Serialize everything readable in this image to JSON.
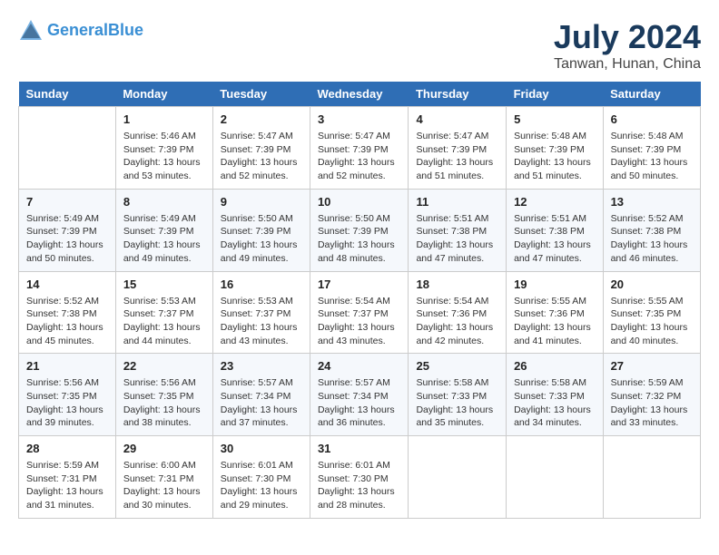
{
  "header": {
    "logo_line1": "General",
    "logo_line2": "Blue",
    "month_year": "July 2024",
    "location": "Tanwan, Hunan, China"
  },
  "days_of_week": [
    "Sunday",
    "Monday",
    "Tuesday",
    "Wednesday",
    "Thursday",
    "Friday",
    "Saturday"
  ],
  "weeks": [
    [
      {
        "day": "",
        "sunrise": "",
        "sunset": "",
        "daylight": ""
      },
      {
        "day": "1",
        "sunrise": "Sunrise: 5:46 AM",
        "sunset": "Sunset: 7:39 PM",
        "daylight": "Daylight: 13 hours and 53 minutes."
      },
      {
        "day": "2",
        "sunrise": "Sunrise: 5:47 AM",
        "sunset": "Sunset: 7:39 PM",
        "daylight": "Daylight: 13 hours and 52 minutes."
      },
      {
        "day": "3",
        "sunrise": "Sunrise: 5:47 AM",
        "sunset": "Sunset: 7:39 PM",
        "daylight": "Daylight: 13 hours and 52 minutes."
      },
      {
        "day": "4",
        "sunrise": "Sunrise: 5:47 AM",
        "sunset": "Sunset: 7:39 PM",
        "daylight": "Daylight: 13 hours and 51 minutes."
      },
      {
        "day": "5",
        "sunrise": "Sunrise: 5:48 AM",
        "sunset": "Sunset: 7:39 PM",
        "daylight": "Daylight: 13 hours and 51 minutes."
      },
      {
        "day": "6",
        "sunrise": "Sunrise: 5:48 AM",
        "sunset": "Sunset: 7:39 PM",
        "daylight": "Daylight: 13 hours and 50 minutes."
      }
    ],
    [
      {
        "day": "7",
        "sunrise": "Sunrise: 5:49 AM",
        "sunset": "Sunset: 7:39 PM",
        "daylight": "Daylight: 13 hours and 50 minutes."
      },
      {
        "day": "8",
        "sunrise": "Sunrise: 5:49 AM",
        "sunset": "Sunset: 7:39 PM",
        "daylight": "Daylight: 13 hours and 49 minutes."
      },
      {
        "day": "9",
        "sunrise": "Sunrise: 5:50 AM",
        "sunset": "Sunset: 7:39 PM",
        "daylight": "Daylight: 13 hours and 49 minutes."
      },
      {
        "day": "10",
        "sunrise": "Sunrise: 5:50 AM",
        "sunset": "Sunset: 7:39 PM",
        "daylight": "Daylight: 13 hours and 48 minutes."
      },
      {
        "day": "11",
        "sunrise": "Sunrise: 5:51 AM",
        "sunset": "Sunset: 7:38 PM",
        "daylight": "Daylight: 13 hours and 47 minutes."
      },
      {
        "day": "12",
        "sunrise": "Sunrise: 5:51 AM",
        "sunset": "Sunset: 7:38 PM",
        "daylight": "Daylight: 13 hours and 47 minutes."
      },
      {
        "day": "13",
        "sunrise": "Sunrise: 5:52 AM",
        "sunset": "Sunset: 7:38 PM",
        "daylight": "Daylight: 13 hours and 46 minutes."
      }
    ],
    [
      {
        "day": "14",
        "sunrise": "Sunrise: 5:52 AM",
        "sunset": "Sunset: 7:38 PM",
        "daylight": "Daylight: 13 hours and 45 minutes."
      },
      {
        "day": "15",
        "sunrise": "Sunrise: 5:53 AM",
        "sunset": "Sunset: 7:37 PM",
        "daylight": "Daylight: 13 hours and 44 minutes."
      },
      {
        "day": "16",
        "sunrise": "Sunrise: 5:53 AM",
        "sunset": "Sunset: 7:37 PM",
        "daylight": "Daylight: 13 hours and 43 minutes."
      },
      {
        "day": "17",
        "sunrise": "Sunrise: 5:54 AM",
        "sunset": "Sunset: 7:37 PM",
        "daylight": "Daylight: 13 hours and 43 minutes."
      },
      {
        "day": "18",
        "sunrise": "Sunrise: 5:54 AM",
        "sunset": "Sunset: 7:36 PM",
        "daylight": "Daylight: 13 hours and 42 minutes."
      },
      {
        "day": "19",
        "sunrise": "Sunrise: 5:55 AM",
        "sunset": "Sunset: 7:36 PM",
        "daylight": "Daylight: 13 hours and 41 minutes."
      },
      {
        "day": "20",
        "sunrise": "Sunrise: 5:55 AM",
        "sunset": "Sunset: 7:35 PM",
        "daylight": "Daylight: 13 hours and 40 minutes."
      }
    ],
    [
      {
        "day": "21",
        "sunrise": "Sunrise: 5:56 AM",
        "sunset": "Sunset: 7:35 PM",
        "daylight": "Daylight: 13 hours and 39 minutes."
      },
      {
        "day": "22",
        "sunrise": "Sunrise: 5:56 AM",
        "sunset": "Sunset: 7:35 PM",
        "daylight": "Daylight: 13 hours and 38 minutes."
      },
      {
        "day": "23",
        "sunrise": "Sunrise: 5:57 AM",
        "sunset": "Sunset: 7:34 PM",
        "daylight": "Daylight: 13 hours and 37 minutes."
      },
      {
        "day": "24",
        "sunrise": "Sunrise: 5:57 AM",
        "sunset": "Sunset: 7:34 PM",
        "daylight": "Daylight: 13 hours and 36 minutes."
      },
      {
        "day": "25",
        "sunrise": "Sunrise: 5:58 AM",
        "sunset": "Sunset: 7:33 PM",
        "daylight": "Daylight: 13 hours and 35 minutes."
      },
      {
        "day": "26",
        "sunrise": "Sunrise: 5:58 AM",
        "sunset": "Sunset: 7:33 PM",
        "daylight": "Daylight: 13 hours and 34 minutes."
      },
      {
        "day": "27",
        "sunrise": "Sunrise: 5:59 AM",
        "sunset": "Sunset: 7:32 PM",
        "daylight": "Daylight: 13 hours and 33 minutes."
      }
    ],
    [
      {
        "day": "28",
        "sunrise": "Sunrise: 5:59 AM",
        "sunset": "Sunset: 7:31 PM",
        "daylight": "Daylight: 13 hours and 31 minutes."
      },
      {
        "day": "29",
        "sunrise": "Sunrise: 6:00 AM",
        "sunset": "Sunset: 7:31 PM",
        "daylight": "Daylight: 13 hours and 30 minutes."
      },
      {
        "day": "30",
        "sunrise": "Sunrise: 6:01 AM",
        "sunset": "Sunset: 7:30 PM",
        "daylight": "Daylight: 13 hours and 29 minutes."
      },
      {
        "day": "31",
        "sunrise": "Sunrise: 6:01 AM",
        "sunset": "Sunset: 7:30 PM",
        "daylight": "Daylight: 13 hours and 28 minutes."
      },
      {
        "day": "",
        "sunrise": "",
        "sunset": "",
        "daylight": ""
      },
      {
        "day": "",
        "sunrise": "",
        "sunset": "",
        "daylight": ""
      },
      {
        "day": "",
        "sunrise": "",
        "sunset": "",
        "daylight": ""
      }
    ]
  ]
}
